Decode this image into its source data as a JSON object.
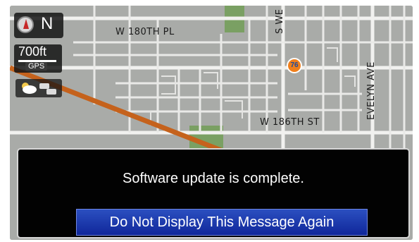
{
  "compass": {
    "heading": "N",
    "icon": "compass-needle-icon"
  },
  "scale": {
    "value": "700ft",
    "source_label": "GPS"
  },
  "weather_traffic": {
    "icon": "weather-traffic-icon"
  },
  "streets": {
    "w180": "W 180TH PL",
    "w186": "W 186TH ST",
    "evelyn": "EVELYN AVE",
    "swe": "S WE"
  },
  "poi": {
    "label": "76",
    "icon": "gas-station-76-icon"
  },
  "dialog": {
    "message": "Software update is complete.",
    "button_label": "Do Not Display This Message Again"
  },
  "colors": {
    "map_bg": "#a9aba8",
    "road": "#f1f1ef",
    "highway": "#d2691e",
    "park": "#7aa063",
    "button": "#1b35aa"
  }
}
